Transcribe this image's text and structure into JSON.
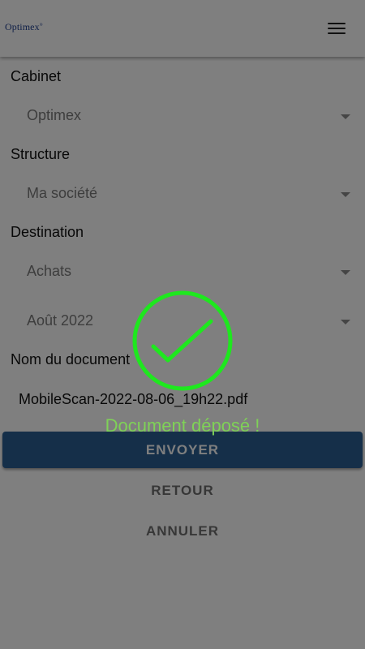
{
  "header": {
    "logo_text": "Optimex",
    "logo_mark": "®",
    "menu_icon": "hamburger-menu-icon"
  },
  "form": {
    "cabinet": {
      "label": "Cabinet",
      "value": "Optimex"
    },
    "structure": {
      "label": "Structure",
      "value": "Ma société"
    },
    "destination": {
      "label": "Destination",
      "value": "Achats"
    },
    "period": {
      "value": "Août 2022"
    },
    "document_name": {
      "label": "Nom du document",
      "value": "MobileScan-2022-08-06_19h22.pdf"
    }
  },
  "actions": {
    "send": "ENVOYER",
    "back": "RETOUR",
    "cancel": "ANNULER"
  },
  "overlay": {
    "icon": "check-circle-icon",
    "message": "Document déposé !"
  },
  "colors": {
    "primary_button": "#2b5f93",
    "success_green": "#1ee81e",
    "success_text": "#7fd257",
    "logo_blue": "#1f3f8f"
  }
}
